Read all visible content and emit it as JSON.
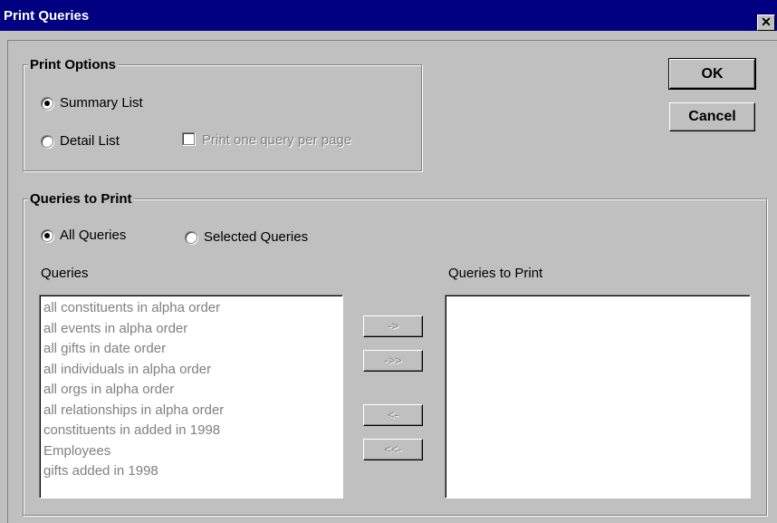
{
  "window": {
    "title": "Print Queries",
    "close_glyph": "✕"
  },
  "buttons": {
    "ok": "OK",
    "cancel": "Cancel"
  },
  "print_options": {
    "legend": "Print Options",
    "summary_list": "Summary List",
    "detail_list": "Detail List",
    "one_per_page": "Print one query per page",
    "selected": "summary_list"
  },
  "queries_to_print": {
    "legend": "Queries to Print",
    "all_queries": "All Queries",
    "selected_queries": "Selected Queries",
    "selected": "all_queries",
    "left_list_label": "Queries",
    "right_list_label": "Queries to Print",
    "queries": [
      "all constituents in alpha order",
      "all events in alpha order",
      "all gifts in date order",
      "all individuals in alpha order",
      "all orgs in alpha order",
      "all relationships in alpha order",
      "constituents in added in 1998",
      "Employees",
      "gifts added in 1998"
    ],
    "queries_to_print": [],
    "move_buttons": {
      "add": "->",
      "add_all": "->>",
      "remove": "<-",
      "remove_all": "<<-"
    }
  }
}
